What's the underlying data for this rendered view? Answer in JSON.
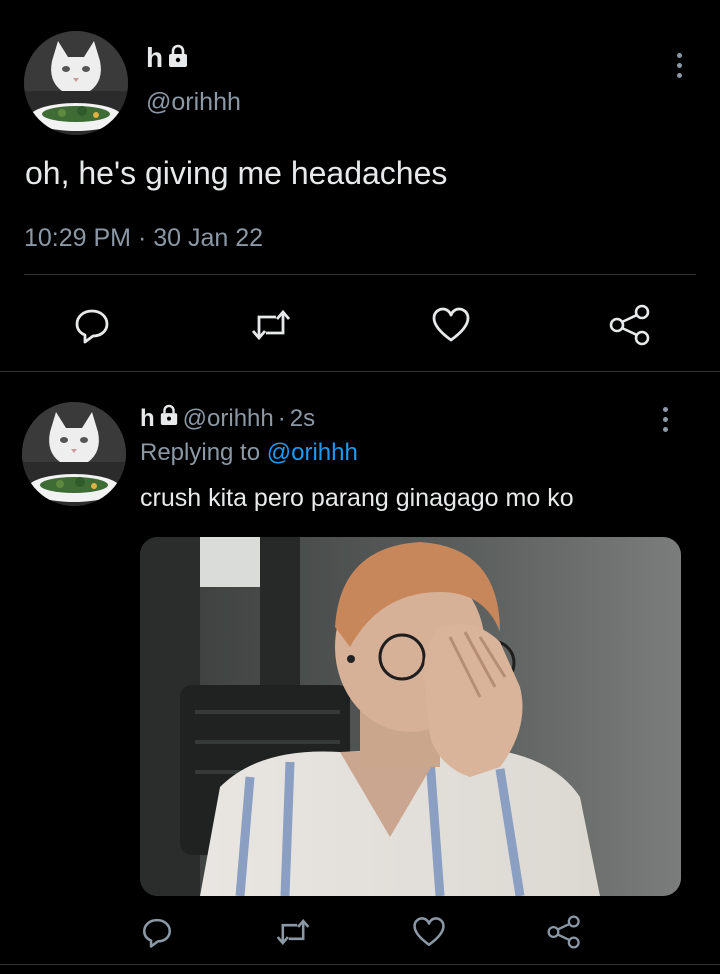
{
  "main_tweet": {
    "author_name": "h",
    "author_handle": "@orihhh",
    "text": "oh, he's giving me headaches",
    "time": "10:29 PM",
    "separator": "·",
    "date": "30 Jan 22",
    "icons": {
      "avatar": "cat-avatar",
      "lock": "lock-icon",
      "more": "more-vertical-icon"
    }
  },
  "reply_tweet": {
    "author_name": "h",
    "author_handle": "@orihhh",
    "age_separator": "·",
    "age": "2s",
    "replying_prefix": "Replying to",
    "replying_handle": "@orihhh",
    "text": "crush kita pero parang ginagago mo ko",
    "media_description_icon": "photo-image"
  },
  "actions": [
    "reply-icon",
    "retweet-icon",
    "like-icon",
    "share-icon"
  ],
  "colors": {
    "background": "#000000",
    "text": "#e7e9ea",
    "muted": "#8b98a5",
    "link": "#1d9bf0",
    "divider": "#2f3336"
  }
}
